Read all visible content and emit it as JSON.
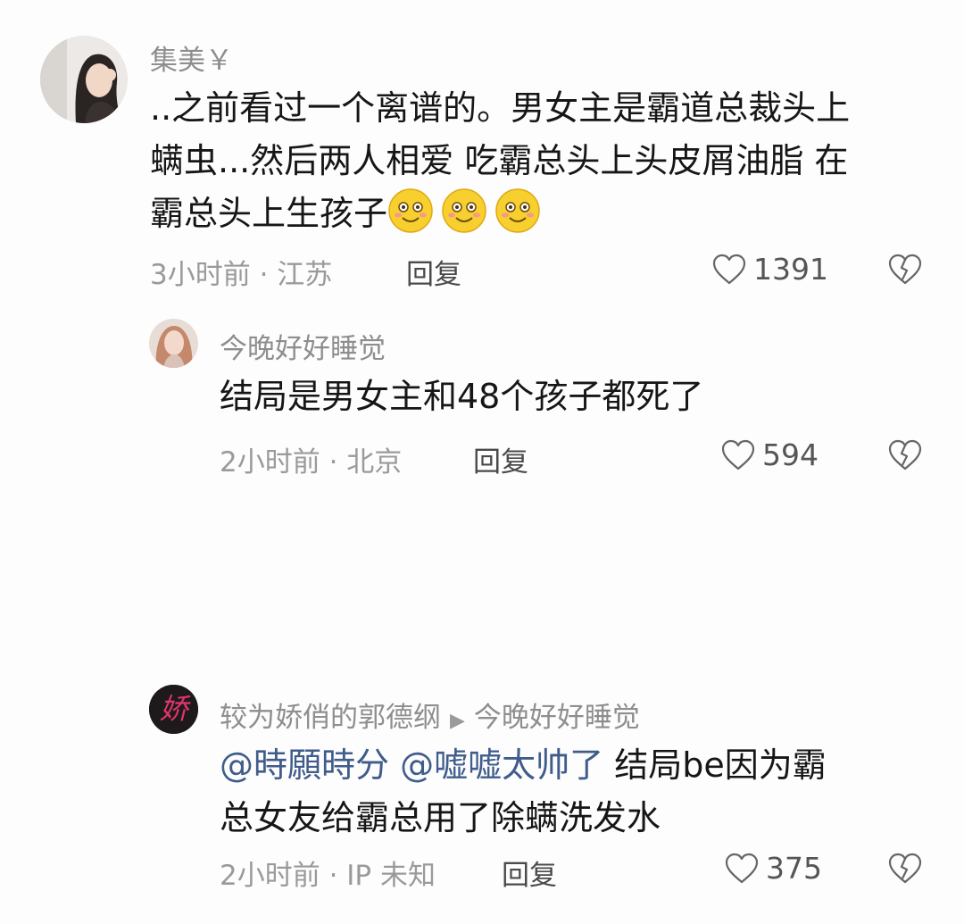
{
  "comments": [
    {
      "username": "集美￥",
      "text_lines": [
        "..之前看过一个离谱的。男女主是霸道总裁头上",
        "螨虫...然后两人相爱 吃霸总头上头皮屑油脂 在",
        "霸总头上生孩子"
      ],
      "emoji": "smile-emoji",
      "emoji_count": 3,
      "meta": "3小时前 · 江苏",
      "reply_label": "回复",
      "likes": "1391"
    },
    {
      "username": "今晚好好睡觉",
      "text": "结局是男女主和48个孩子都死了",
      "meta": "2小时前 · 北京",
      "reply_label": "回复",
      "likes": "594"
    },
    {
      "username": "较为娇俏的郭德纲",
      "reply_to": "今晚好好睡觉",
      "avatar_text": "娇",
      "mentions": [
        "@時願時分",
        "@嘘嘘太帅了"
      ],
      "text_after_mentions": "结局be因为霸",
      "text_line2": "总女友给霸总用了除螨洗发水",
      "meta": "2小时前 · IP 未知",
      "reply_label": "回复",
      "likes": "375"
    }
  ],
  "icons": {
    "like": "heart-outline-icon",
    "dislike": "broken-heart-icon",
    "reply_arrow": "triangle-right-icon"
  },
  "colors": {
    "mention": "#3f5c8c",
    "meta": "#9a9a9a",
    "username": "#8e8e8e"
  }
}
